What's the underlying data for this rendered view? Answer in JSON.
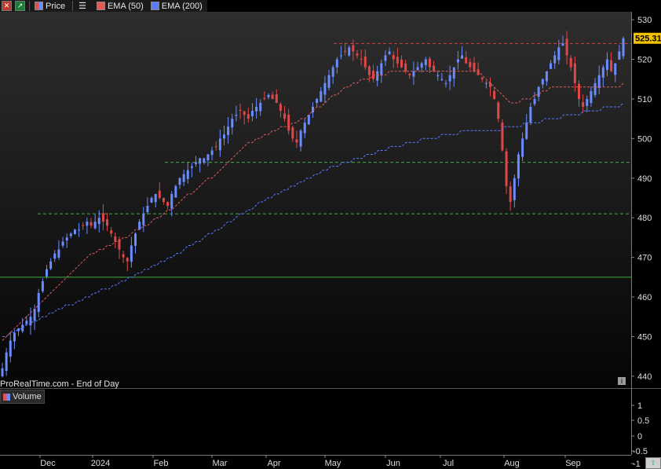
{
  "legend": {
    "price_label": "Price",
    "ema50_label": "EMA (50)",
    "ema200_label": "EMA (200)"
  },
  "source_label": "ProRealTime.com - End of Day",
  "volume_label": "Volume",
  "colors": {
    "up_candle": "#6a8cff",
    "down_candle": "#e04848",
    "ema50": "#e05a5a",
    "ema200": "#5a7aff",
    "support_green": "#3cb043",
    "resistance_red": "#d04040"
  },
  "chart_data": {
    "type": "candlestick",
    "price_axis": {
      "ticks": [
        440,
        450,
        460,
        470,
        480,
        490,
        500,
        510,
        520,
        530
      ]
    },
    "current_price_label": "525.31",
    "x_axis": {
      "labels": [
        "Dec",
        "2024",
        "Feb",
        "Mar",
        "Apr",
        "May",
        "Jun",
        "Jul",
        "Aug",
        "Sep"
      ]
    },
    "closes": [
      442,
      446,
      449,
      451,
      452,
      453,
      454,
      455,
      457,
      461,
      464,
      467,
      469,
      471,
      472,
      474,
      475,
      476,
      477,
      477,
      478,
      479,
      478,
      479,
      480,
      479,
      478,
      476,
      474,
      472,
      470,
      469,
      473,
      476,
      479,
      481,
      483,
      485,
      486,
      485,
      484,
      483,
      486,
      488,
      490,
      491,
      492,
      493,
      494,
      495,
      495,
      496,
      497,
      498,
      500,
      501,
      503,
      505,
      506,
      507,
      506,
      505,
      507,
      508,
      509,
      510,
      511,
      510,
      509,
      507,
      505,
      502,
      500,
      499,
      502,
      504,
      506,
      508,
      510,
      512,
      514,
      516,
      518,
      520,
      521,
      522,
      523,
      522,
      521,
      520,
      518,
      516,
      515,
      517,
      519,
      521,
      522,
      520,
      519,
      518,
      517,
      516,
      517,
      518,
      519,
      520,
      518,
      517,
      516,
      515,
      514,
      516,
      518,
      520,
      521,
      519,
      518,
      517,
      516,
      515,
      514,
      513,
      510,
      505,
      497,
      488,
      484,
      490,
      496,
      500,
      504,
      508,
      510,
      513,
      515,
      517,
      519,
      521,
      523,
      524,
      521,
      518,
      514,
      510,
      508,
      510,
      512,
      514,
      516,
      518,
      520,
      517,
      519,
      522,
      525.31
    ],
    "ema50": [
      449,
      450,
      451,
      452,
      453,
      454,
      455,
      456,
      457,
      458,
      459,
      460,
      461,
      462,
      463,
      464,
      465,
      466,
      467,
      468,
      469,
      470,
      471,
      471,
      472,
      472,
      473,
      473,
      474,
      474,
      475,
      475,
      476,
      477,
      477,
      478,
      478,
      479,
      480,
      480,
      481,
      482,
      482,
      483,
      484,
      485,
      486,
      486,
      487,
      488,
      489,
      490,
      490,
      491,
      492,
      493,
      494,
      495,
      496,
      497,
      498,
      499,
      499,
      500,
      500,
      501,
      501,
      502,
      502,
      503,
      503,
      503,
      504,
      504,
      505,
      505,
      506,
      507,
      508,
      508,
      509,
      510,
      511,
      511,
      512,
      513,
      513,
      514,
      514,
      515,
      515,
      515,
      516,
      516,
      516,
      516,
      517,
      517,
      517,
      517,
      517,
      517,
      517,
      517,
      517,
      517,
      517,
      517,
      517,
      517,
      517,
      517,
      517,
      517,
      517,
      517,
      517,
      517,
      517,
      516,
      515,
      514,
      513,
      512,
      511,
      510,
      509,
      509,
      509,
      510,
      510,
      510,
      511,
      511,
      512,
      512,
      513,
      513,
      513,
      513,
      513,
      513,
      513,
      513,
      513,
      513,
      513,
      513,
      513,
      513,
      513,
      513,
      513,
      513,
      514
    ],
    "ema200": [
      450,
      450,
      451,
      451,
      452,
      452,
      453,
      453,
      454,
      454,
      455,
      455,
      456,
      456,
      457,
      457,
      458,
      458,
      458,
      459,
      459,
      460,
      460,
      461,
      461,
      462,
      462,
      462,
      463,
      463,
      464,
      464,
      465,
      465,
      466,
      466,
      467,
      467,
      468,
      468,
      469,
      469,
      470,
      470,
      471,
      471,
      472,
      473,
      473,
      474,
      474,
      475,
      476,
      476,
      477,
      477,
      478,
      479,
      479,
      480,
      481,
      481,
      482,
      482,
      483,
      484,
      484,
      485,
      485,
      486,
      486,
      487,
      487,
      488,
      488,
      489,
      489,
      490,
      490,
      491,
      491,
      492,
      492,
      493,
      493,
      493,
      494,
      494,
      494,
      495,
      495,
      495,
      496,
      496,
      496,
      497,
      497,
      497,
      498,
      498,
      498,
      498,
      499,
      499,
      499,
      499,
      500,
      500,
      500,
      500,
      500,
      501,
      501,
      501,
      501,
      501,
      502,
      502,
      502,
      502,
      502,
      502,
      502,
      502,
      502,
      502,
      502,
      503,
      503,
      503,
      503,
      503,
      504,
      504,
      504,
      504,
      504,
      505,
      505,
      505,
      505,
      505,
      506,
      506,
      506,
      506,
      506,
      507,
      507,
      507,
      507,
      507,
      508,
      508,
      508,
      508,
      508,
      509
    ],
    "horizontal_lines": [
      {
        "level": 524,
        "color": "red",
        "style": "dashed"
      },
      {
        "level": 494,
        "color": "green",
        "style": "dashed"
      },
      {
        "level": 481,
        "color": "green",
        "style": "dashed"
      },
      {
        "level": 465,
        "color": "green",
        "style": "solid"
      }
    ],
    "volume_axis": {
      "ticks": [
        "1",
        "0.5",
        "0",
        "-0.5",
        "-1"
      ]
    }
  }
}
